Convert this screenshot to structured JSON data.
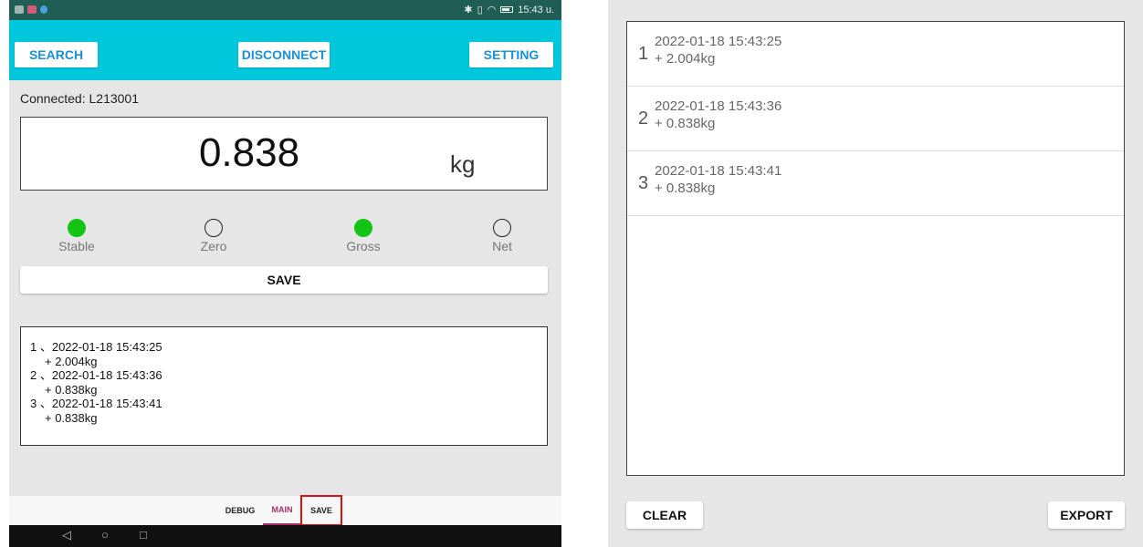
{
  "status_bar": {
    "time": "15:43 u."
  },
  "header": {
    "search_label": "SEARCH",
    "disconnect_label": "DISCONNECT",
    "setting_label": "SETTING"
  },
  "connection": {
    "text": "Connected:  L213001"
  },
  "weight": {
    "value": "0.838",
    "unit": "kg"
  },
  "indicators": [
    {
      "label": "Stable",
      "on": true
    },
    {
      "label": "Zero",
      "on": false
    },
    {
      "label": "Gross",
      "on": true
    },
    {
      "label": "Net",
      "on": false
    }
  ],
  "save_label": "SAVE",
  "log": {
    "lines": [
      "1 、2022-01-18 15:43:25",
      "+ 2.004kg",
      "2 、2022-01-18 15:43:36",
      "+ 0.838kg",
      "3 、2022-01-18 15:43:41",
      "+ 0.838kg"
    ]
  },
  "tabs": {
    "debug": "DEBUG",
    "main": "MAIN",
    "save": "SAVE"
  },
  "saved_list": {
    "items": [
      {
        "index": "1",
        "date": "2022-01-18 15:43:25",
        "weight": "+ 2.004kg"
      },
      {
        "index": "2",
        "date": "2022-01-18 15:43:36",
        "weight": "+ 0.838kg"
      },
      {
        "index": "3",
        "date": "2022-01-18 15:43:41",
        "weight": "+ 0.838kg"
      }
    ],
    "clear_label": "CLEAR",
    "export_label": "EXPORT"
  },
  "colors": {
    "app_bar": "#00c7dc",
    "status_bar": "#1f5d55",
    "indicator_on": "#14c414",
    "tab_active": "#a3306c",
    "highlight": "#e01010"
  }
}
